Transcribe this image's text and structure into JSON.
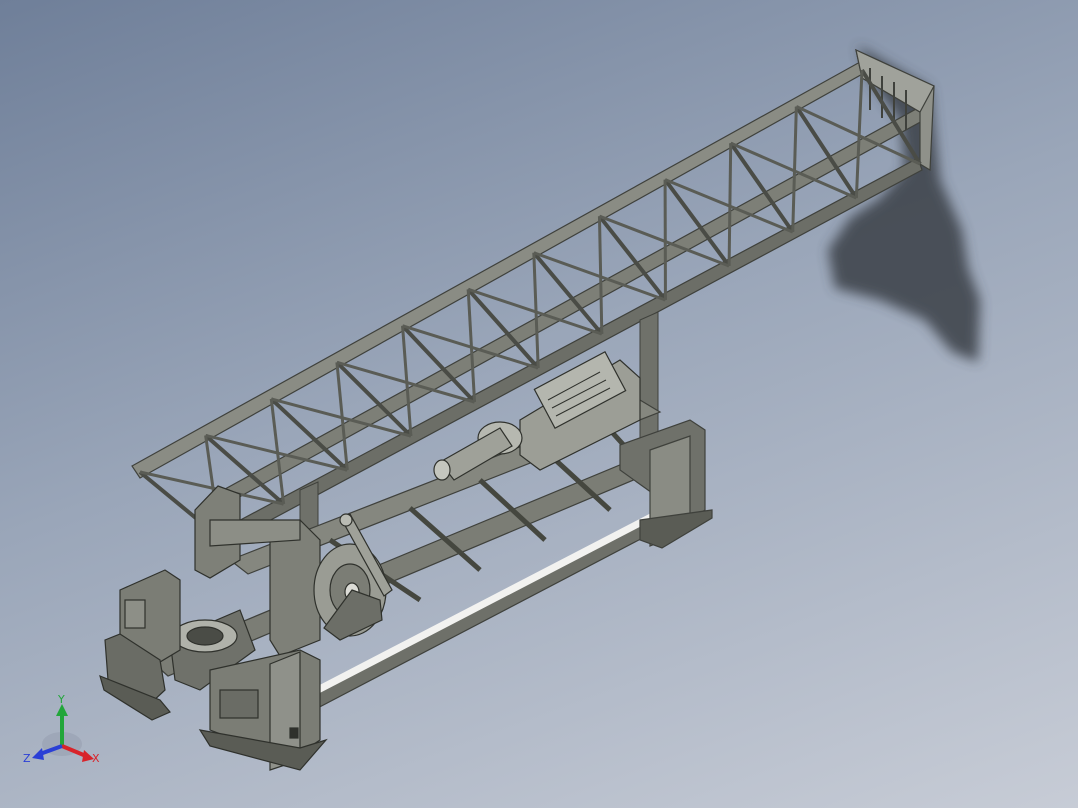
{
  "viewport": {
    "background_top": "#6f7f99",
    "background_bottom": "#c7ccd6"
  },
  "model": {
    "steel_color": "#7d7f77",
    "steel_dark": "#3f413c",
    "steel_light": "#a9aba3",
    "shadow_color": "#3b3f47"
  },
  "triad": {
    "x_label": "X",
    "y_label": "Y",
    "z_label": "Z",
    "x_color": "#d8232a",
    "y_color": "#22a63a",
    "z_color": "#2a3fd6"
  }
}
